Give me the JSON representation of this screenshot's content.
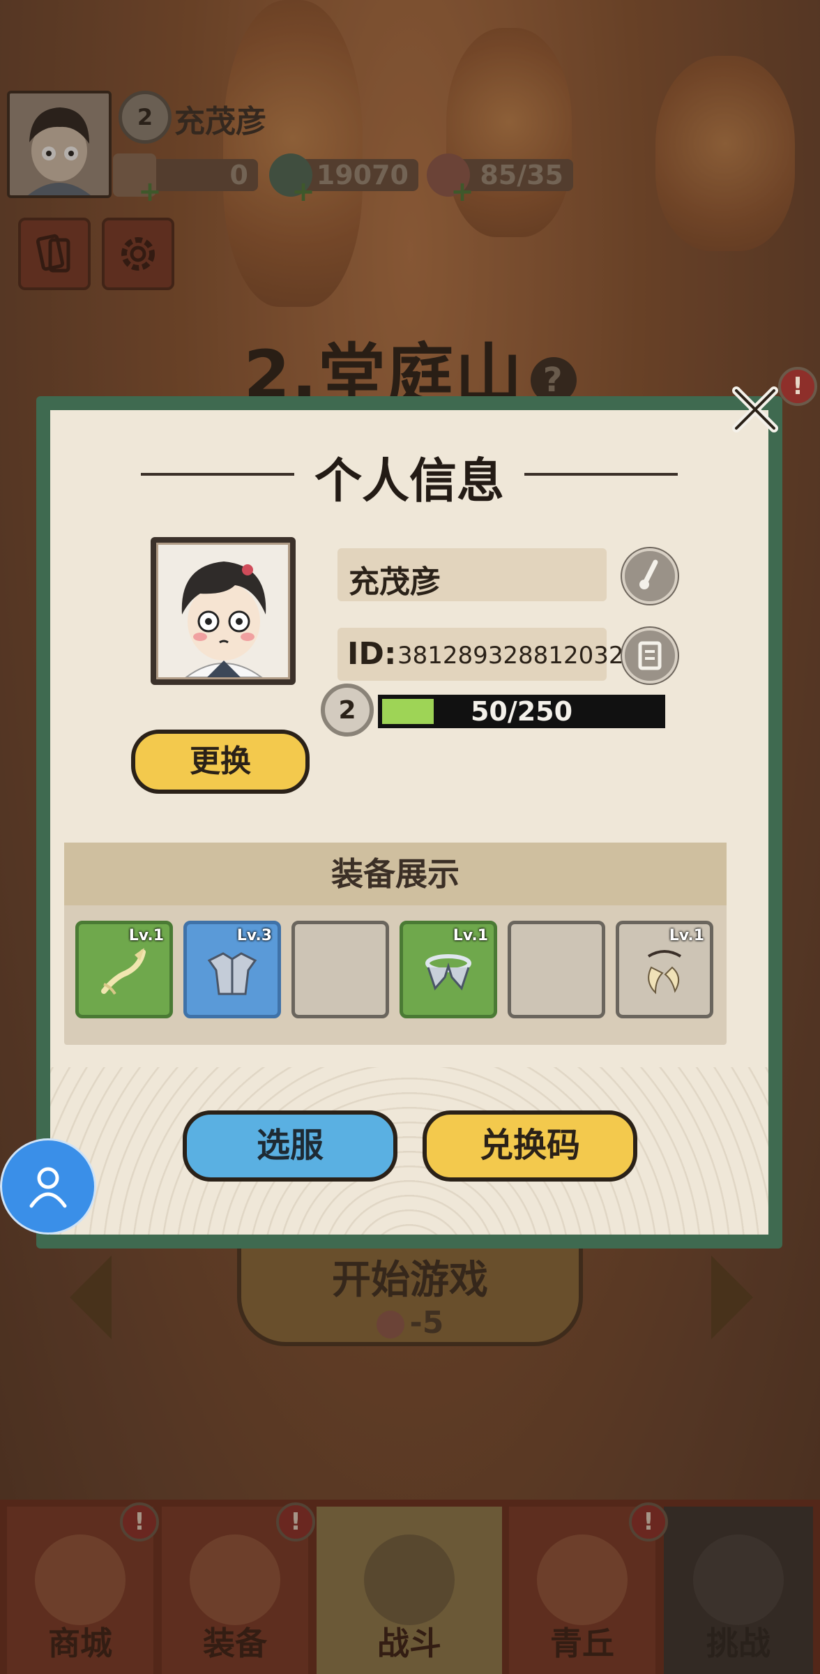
{
  "hud": {
    "player_name": "充茂彦",
    "level": "2",
    "scrolls": "0",
    "coins": "19070",
    "stamina": "85/35"
  },
  "stage": {
    "title": "2.堂庭山",
    "help_icon": "?"
  },
  "start": {
    "label": "开始游戏",
    "cost": "-5"
  },
  "nav": [
    {
      "label": "商城",
      "badge": "!"
    },
    {
      "label": "装备",
      "badge": "!"
    },
    {
      "label": "战斗",
      "badge": ""
    },
    {
      "label": "青丘",
      "badge": "!"
    },
    {
      "label": "挑战",
      "badge": ""
    }
  ],
  "modal": {
    "title": "个人信息",
    "close_badge": "!",
    "change_avatar_label": "更换",
    "name": "充茂彦",
    "id_label": "ID:",
    "id_value": "381289328812032",
    "level": "2",
    "xp_text": "50/250",
    "xp_progress": 0.2,
    "equip_title": "装备展示",
    "slots": [
      {
        "level": "Lv.1",
        "rarity": "green",
        "item": "whip-weapon"
      },
      {
        "level": "Lv.3",
        "rarity": "blue",
        "item": "armor"
      },
      {
        "level": "",
        "rarity": "empty",
        "item": ""
      },
      {
        "level": "Lv.1",
        "rarity": "green",
        "item": "belt"
      },
      {
        "level": "",
        "rarity": "empty",
        "item": ""
      },
      {
        "level": "Lv.1",
        "rarity": "empty",
        "item": "claw-accessory"
      }
    ],
    "server_button": "选服",
    "redeem_button": "兑换码"
  },
  "colors": {
    "frame_green": "#3f6a50",
    "button_yellow": "#f3c94d",
    "button_blue": "#5ab0e2",
    "xp_fill": "#9ed456",
    "slot_green": "#6fa84c",
    "slot_blue": "#5a9ad8"
  }
}
